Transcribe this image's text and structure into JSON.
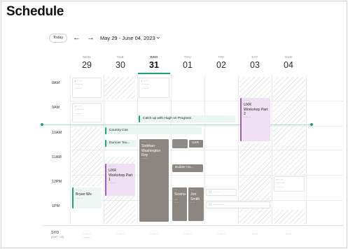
{
  "page": {
    "title": "Schedule"
  },
  "toolbar": {
    "today_label": "Today",
    "prev_label": "←",
    "next_label": "→",
    "date_range": "May 29 - June 04, 2023"
  },
  "days": [
    {
      "name": "MON",
      "num": "29"
    },
    {
      "name": "TUE",
      "num": "30"
    },
    {
      "name": "WED",
      "num": "31"
    },
    {
      "name": "THU",
      "num": "01"
    },
    {
      "name": "FRI",
      "num": "02"
    },
    {
      "name": "SAT",
      "num": "03"
    },
    {
      "name": "SUN",
      "num": "04"
    }
  ],
  "hours": [
    "8AM",
    "9AM",
    "10AM",
    "11AM",
    "12PM",
    "1PM"
  ],
  "events": {
    "catch_up": "Catch up with Hugh on Progress",
    "country_cos": "Country Cos",
    "duncan_tour": "Duncan Tou...",
    "uxr_workshop_tue": {
      "title": "UXR Workshop Part 1"
    },
    "uxr_workshop_sat": {
      "title": "UXR Workshop Part 2"
    },
    "siobhan": {
      "title": "Siobhan Washington Roy"
    },
    "uxr_thu": "UXR",
    "builder_thu": "Builder Ho...",
    "bryan": {
      "title": "Bryan Wu"
    },
    "sue_gray": {
      "title": "Susina ..."
    },
    "jon_smith": {
      "title": "Jon Smith"
    }
  },
  "footer": {
    "tz_label": "SYD",
    "tz_sub": "(GMT +10)"
  },
  "colors": {
    "accent": "#1aa37a",
    "event_purple": "#efe0f3",
    "event_gray": "#8c8681"
  }
}
